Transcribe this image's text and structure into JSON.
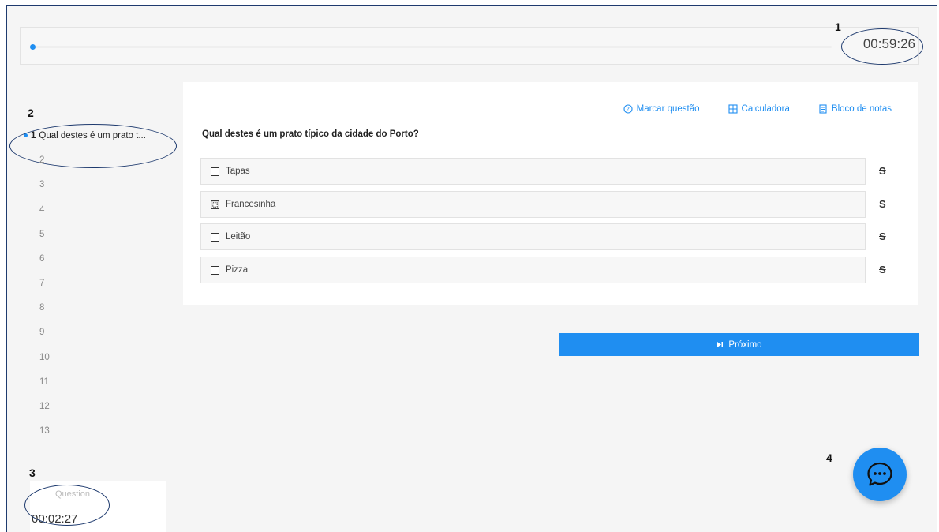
{
  "annotations": {
    "n1": "1",
    "n2": "2",
    "n3": "3",
    "n4": "4"
  },
  "header": {
    "timer": "00:59:26",
    "progress_fraction": 0.0
  },
  "sidebar": {
    "items": [
      {
        "num": "1",
        "label": "Qual destes é um prato t...",
        "active": true
      },
      {
        "num": "2"
      },
      {
        "num": "3"
      },
      {
        "num": "4"
      },
      {
        "num": "5"
      },
      {
        "num": "6"
      },
      {
        "num": "7"
      },
      {
        "num": "8"
      },
      {
        "num": "9"
      },
      {
        "num": "10"
      },
      {
        "num": "11"
      },
      {
        "num": "12"
      },
      {
        "num": "13"
      }
    ]
  },
  "question_timer": {
    "label": "Question",
    "value": "00:02:27"
  },
  "toolbar": {
    "mark_label": "Marcar questão",
    "calculator_label": "Calculadora",
    "notes_label": "Bloco de notas"
  },
  "question": {
    "title": "Qual destes é um prato típico da cidade do Porto?",
    "options": [
      {
        "label": "Tapas",
        "state": "empty"
      },
      {
        "label": "Francesinha",
        "state": "dashed"
      },
      {
        "label": "Leitão",
        "state": "empty"
      },
      {
        "label": "Pizza",
        "state": "empty"
      }
    ],
    "strike_glyph": "S"
  },
  "next_button": {
    "label": "Próximo"
  },
  "colors": {
    "accent": "#1f8ef1",
    "annotation": "#1e3a6e"
  }
}
